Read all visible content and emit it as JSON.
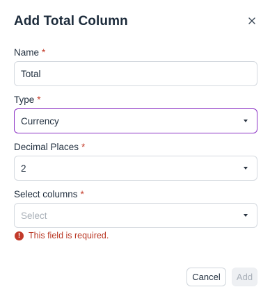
{
  "dialog": {
    "title": "Add Total Column",
    "close_icon": "close-icon"
  },
  "fields": {
    "name": {
      "label": "Name",
      "required_mark": "*",
      "value": "Total"
    },
    "type": {
      "label": "Type",
      "required_mark": "*",
      "value": "Currency"
    },
    "decimal_places": {
      "label": "Decimal Places",
      "required_mark": "*",
      "value": "2"
    },
    "select_columns": {
      "label": "Select columns",
      "required_mark": "*",
      "placeholder": "Select",
      "error": "This field is required.",
      "error_icon_glyph": "!"
    }
  },
  "buttons": {
    "cancel": "Cancel",
    "add": "Add"
  },
  "colors": {
    "focus_border": "#8a2fc4",
    "required": "#c43d2b",
    "error": "#b93623"
  }
}
